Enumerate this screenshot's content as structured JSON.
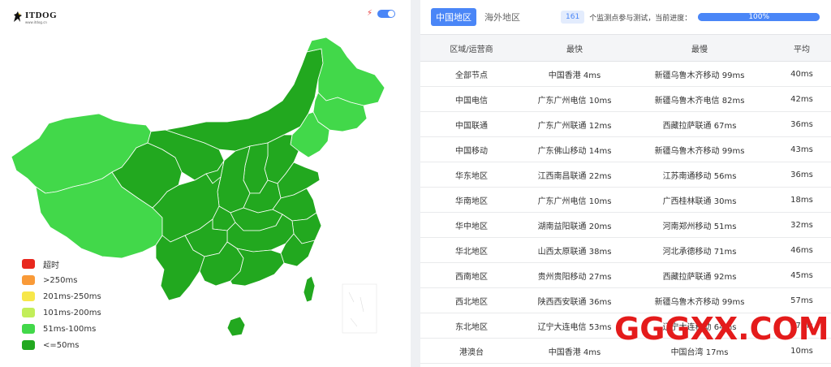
{
  "logo": {
    "title": "ITDOG",
    "subtitle": "www.itdog.cn"
  },
  "colors": {
    "timeout": "#e8281e",
    "over250": "#f99a38",
    "r201_250": "#f7e74a",
    "r101_200": "#c2ee5a",
    "r51_100": "#42d84a",
    "le50": "#22a81f",
    "accent": "#4a86f7",
    "watermark": "#e41b1b"
  },
  "legend": [
    {
      "label": "超时",
      "color": "#e8281e"
    },
    {
      "label": ">250ms",
      "color": "#f99a38"
    },
    {
      "label": "201ms-250ms",
      "color": "#f7e74a"
    },
    {
      "label": "101ms-200ms",
      "color": "#c2ee5a"
    },
    {
      "label": "51ms-100ms",
      "color": "#42d84a"
    },
    {
      "label": "<=50ms",
      "color": "#22a81f"
    }
  ],
  "tabs": {
    "domestic": "中国地区",
    "overseas": "海外地区"
  },
  "status": {
    "node_count": "161",
    "text": "个监测点参与测试，当前进度：",
    "progress_label": "100%",
    "progress": 1.0
  },
  "table": {
    "headers": [
      "区域/运营商",
      "最快",
      "最慢",
      "平均"
    ],
    "rows": [
      [
        "全部节点",
        "中国香港 4ms",
        "新疆乌鲁木齐移动 99ms",
        "40ms"
      ],
      [
        "中国电信",
        "广东广州电信 10ms",
        "新疆乌鲁木齐电信 82ms",
        "42ms"
      ],
      [
        "中国联通",
        "广东广州联通 12ms",
        "西藏拉萨联通 67ms",
        "36ms"
      ],
      [
        "中国移动",
        "广东佛山移动 14ms",
        "新疆乌鲁木齐移动 99ms",
        "43ms"
      ],
      [
        "华东地区",
        "江西南昌联通 22ms",
        "江苏南通移动 56ms",
        "36ms"
      ],
      [
        "华南地区",
        "广东广州电信 10ms",
        "广西桂林联通 30ms",
        "18ms"
      ],
      [
        "华中地区",
        "湖南益阳联通 20ms",
        "河南郑州移动 51ms",
        "32ms"
      ],
      [
        "华北地区",
        "山西太原联通 38ms",
        "河北承德移动 71ms",
        "46ms"
      ],
      [
        "西南地区",
        "贵州贵阳移动 27ms",
        "西藏拉萨联通 92ms",
        "45ms"
      ],
      [
        "西北地区",
        "陕西西安联通 36ms",
        "新疆乌鲁木齐移动 99ms",
        "57ms"
      ],
      [
        "东北地区",
        "辽宁大连电信 53ms",
        "辽宁大连移动 64ms",
        "57ms"
      ],
      [
        "港澳台",
        "中国香港 4ms",
        "中国台湾 17ms",
        "10ms"
      ]
    ]
  },
  "watermark": "GGGXX.COM"
}
